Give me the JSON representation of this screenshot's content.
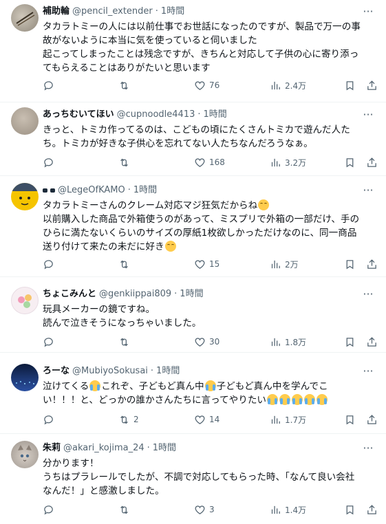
{
  "tweets": [
    {
      "name": "補助輪",
      "handle": "@pencil_extender",
      "time": "1時間",
      "lines": [
        "タカラトミーの人には以前仕事でお世話になったのですが、製品で万一の事",
        "故がないように本当に気を使っていると伺いました",
        "起こってしまったことは残念ですが、きちんと対応して子供の心に寄り添っ",
        "てもらえることはありがたいと思います"
      ],
      "replies": "",
      "retweets": "",
      "likes": "76",
      "views": "2.4万"
    },
    {
      "name": "あっちむいてほい",
      "handle": "@cupnoodle4413",
      "time": "1時間",
      "lines": [
        "きっと、トミカ作ってるのは、こどもの頃にたくさんトミカで遊んだ人た",
        "ち。トミカが好きな子供心を忘れてない人たちなんだろうなぁ。"
      ],
      "replies": "",
      "retweets": "",
      "likes": "168",
      "views": "3.2万"
    },
    {
      "name": "",
      "handle": "@LegeOfKAMO",
      "time": "1時間",
      "lines": [
        "タカラトミーさんのクレーム対応マジ狂気だからね",
        "以前購入した商品で外箱使うのがあって、ミスプリで外箱の一部だけ、手の",
        "ひらに満たないくらいのサイズの厚紙1枚欲しかっただけなのに、同一商品",
        "送り付けて来たの未だに好き"
      ],
      "replies": "",
      "retweets": "",
      "likes": "15",
      "views": "2万"
    },
    {
      "name": "ちょこみんと",
      "handle": "@genkiippai809",
      "time": "1時間",
      "lines": [
        "玩具メーカーの鏡ですね。",
        "読んで泣きそうになっちゃいました。"
      ],
      "replies": "",
      "retweets": "",
      "likes": "30",
      "views": "1.8万"
    },
    {
      "name": "ろーな",
      "handle": "@MubiyoSokusai",
      "time": "1時間",
      "lines": [
        "泣けてくる",
        "これぞ、子どもど真ん中",
        "子どもど真ん中を学んでこ",
        "い！！！と、どっかの誰かさんたちに言ってやりたい"
      ],
      "replies": "",
      "retweets": "2",
      "likes": "14",
      "views": "1.7万"
    },
    {
      "name": "朱莉",
      "handle": "@akari_kojima_24",
      "time": "1時間",
      "lines": [
        "分かります！",
        "うちはプラレールでしたが、不調で対応してもらった時、「なんて良い会社",
        "なんだ！」と感激しました。"
      ],
      "replies": "",
      "retweets": "",
      "likes": "3",
      "views": "1.4万"
    }
  ],
  "icons": {
    "more": "more-icon",
    "reply": "reply-icon",
    "retweet": "retweet-icon",
    "like": "heart-icon",
    "views": "views-icon",
    "bookmark": "bookmark-icon",
    "share": "share-icon"
  },
  "colors": {
    "text": "#0f1419",
    "muted": "#536471",
    "divider": "#eff3f4"
  }
}
